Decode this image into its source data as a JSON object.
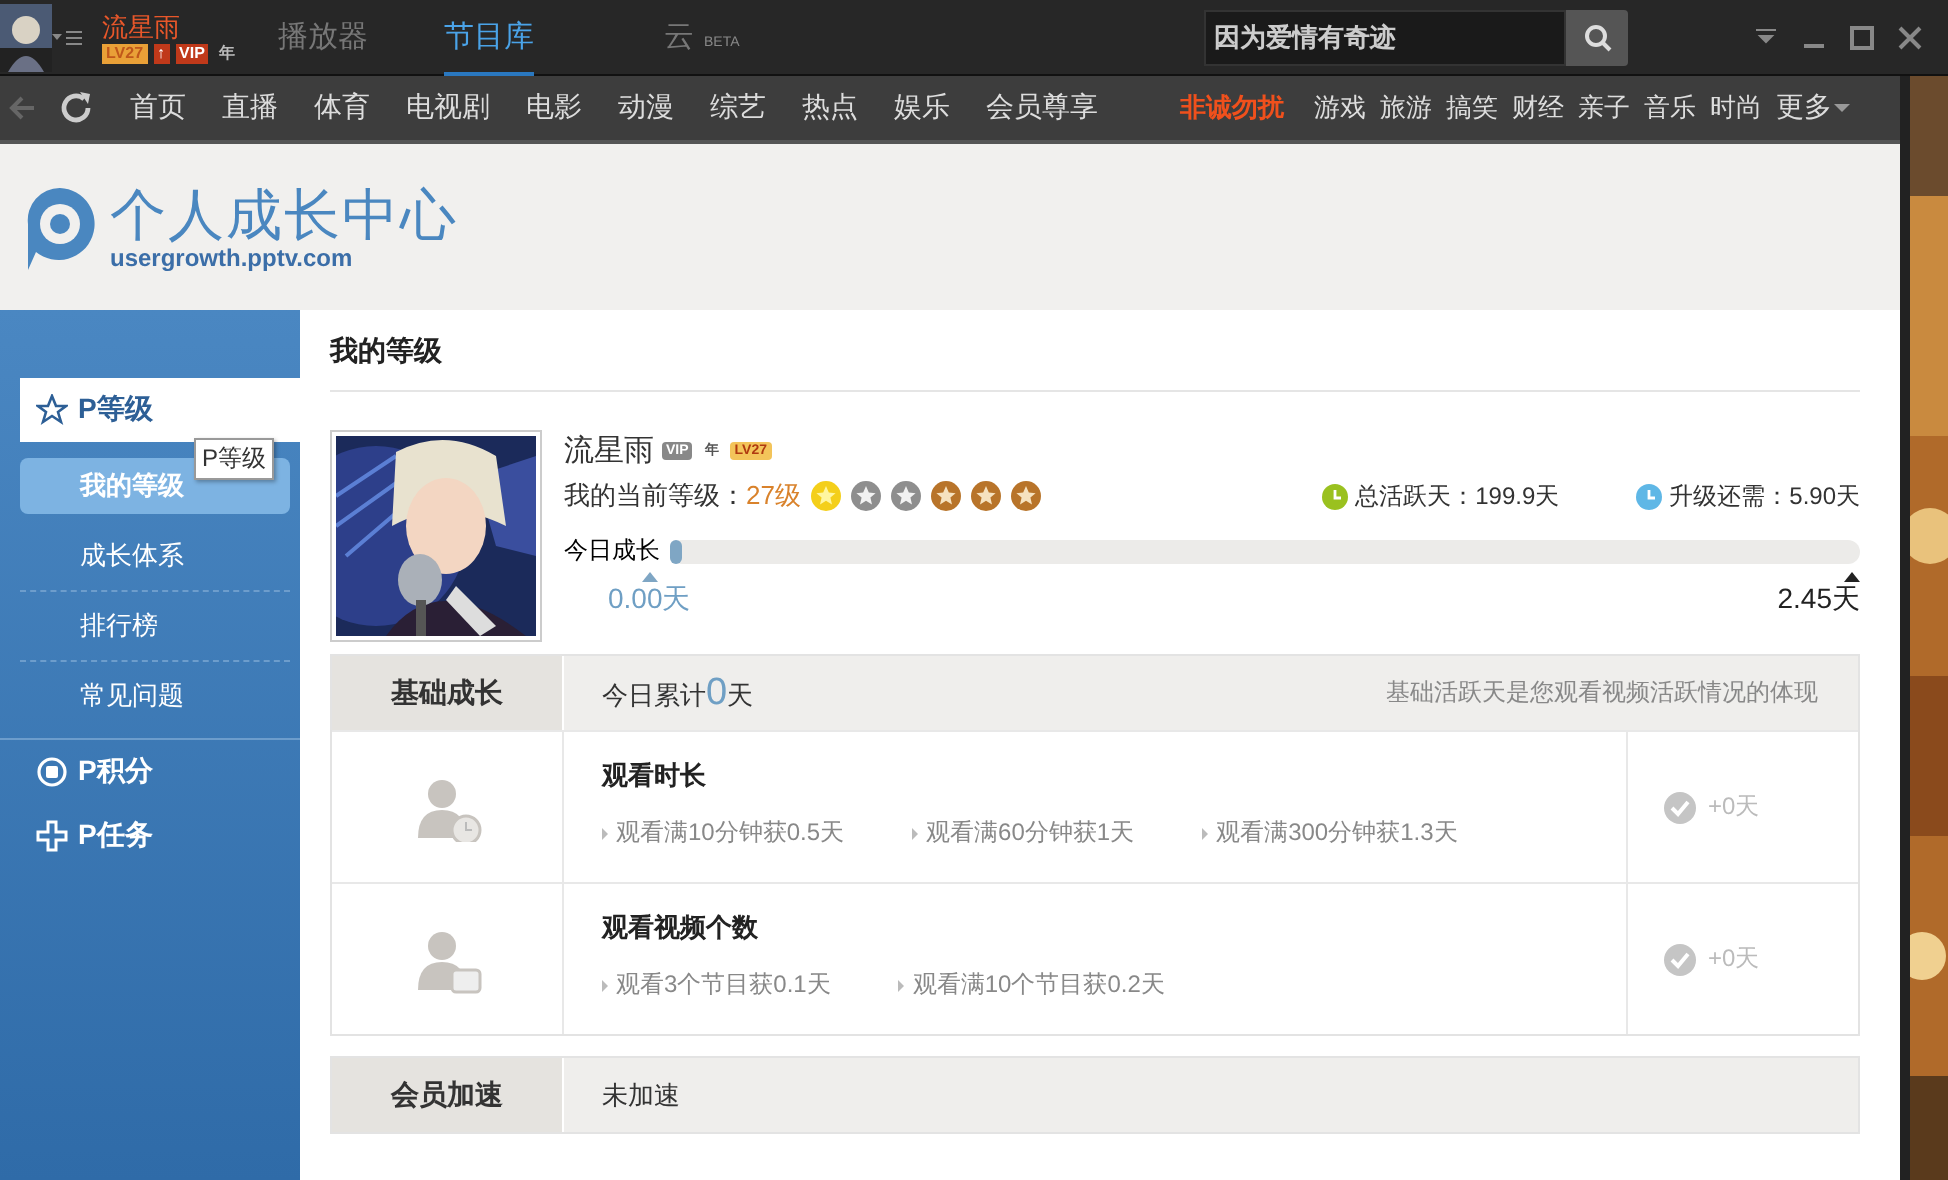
{
  "titlebar": {
    "username": "流星雨",
    "badges": [
      {
        "label": "LV27",
        "kind": "level"
      },
      {
        "label": "↑",
        "kind": "up"
      },
      {
        "label": "VIP",
        "kind": "vip"
      },
      {
        "label": "年",
        "kind": "year"
      }
    ],
    "tabs": [
      {
        "label": "播放器",
        "selected": false
      },
      {
        "label": "节目库",
        "selected": true
      },
      {
        "label": "云",
        "selected": false,
        "superscript": "BETA"
      }
    ],
    "search": {
      "value": "因为爱情有奇迹"
    }
  },
  "navbar": {
    "items": [
      {
        "label": "首页",
        "kind": "main"
      },
      {
        "label": "直播",
        "kind": "main"
      },
      {
        "label": "体育",
        "kind": "main"
      },
      {
        "label": "电视剧",
        "kind": "main"
      },
      {
        "label": "电影",
        "kind": "main"
      },
      {
        "label": "动漫",
        "kind": "main"
      },
      {
        "label": "综艺",
        "kind": "main"
      },
      {
        "label": "热点",
        "kind": "main"
      },
      {
        "label": "娱乐",
        "kind": "main"
      },
      {
        "label": "会员尊享",
        "kind": "main"
      },
      {
        "label": "非诚勿扰",
        "kind": "highlight"
      },
      {
        "label": "游戏",
        "kind": "minor"
      },
      {
        "label": "旅游",
        "kind": "minor"
      },
      {
        "label": "搞笑",
        "kind": "minor"
      },
      {
        "label": "财经",
        "kind": "minor"
      },
      {
        "label": "亲子",
        "kind": "minor"
      },
      {
        "label": "音乐",
        "kind": "minor"
      },
      {
        "label": "时尚",
        "kind": "minor"
      },
      {
        "label": "更多",
        "kind": "dropdown"
      }
    ]
  },
  "header": {
    "title": "个人成长中心",
    "subtitle": "usergrowth.pptv.com"
  },
  "sidebar": {
    "sections": [
      {
        "label": "P等级",
        "kind": "star",
        "selected": true,
        "children": [
          {
            "label": "我的等级",
            "selected": true
          },
          {
            "label": "成长体系",
            "selected": false
          },
          {
            "label": "排行榜",
            "selected": false
          },
          {
            "label": "常见问题",
            "selected": false
          }
        ]
      },
      {
        "label": "P积分",
        "kind": "target",
        "selected": false
      },
      {
        "label": "P任务",
        "kind": "plus",
        "selected": false
      }
    ],
    "tooltip": "P等级"
  },
  "content": {
    "heading": "我的等级",
    "profile": {
      "name": "流星雨",
      "badges": [
        {
          "label": "VIP",
          "kind": "vip"
        },
        {
          "label": "年",
          "kind": "year"
        },
        {
          "label": "LV27",
          "kind": "level"
        }
      ],
      "level_label": "我的当前等级：",
      "level_value": "27级",
      "medals": [
        {
          "kind": "gold"
        },
        {
          "kind": "silver"
        },
        {
          "kind": "silver"
        },
        {
          "kind": "bronze"
        },
        {
          "kind": "bronze"
        },
        {
          "kind": "bronze"
        }
      ],
      "stats": [
        {
          "kind": "total",
          "text": "总活跃天：199.9天"
        },
        {
          "kind": "upgrade",
          "text": "升级还需：5.90天"
        }
      ],
      "progress": {
        "label": "今日成长",
        "level": 0.005,
        "start": "0.00天",
        "end": "2.45天"
      }
    },
    "sections": [
      {
        "title": "基础成长",
        "summary_prefix": "今日累计",
        "summary_value": "0",
        "summary_suffix": "天",
        "note": "基础活跃天是您观看视频活跃情况的体现",
        "rows": [
          {
            "kind": "clock",
            "title": "观看时长",
            "tasks": [
              "观看满10分钟获0.5天",
              "观看满60分钟获1天",
              "观看满300分钟获1.3天"
            ],
            "reward": "+0天"
          },
          {
            "kind": "screen",
            "title": "观看视频个数",
            "tasks": [
              "观看3个节目获0.1天",
              "观看满10个节目获0.2天"
            ],
            "reward": "+0天"
          }
        ]
      },
      {
        "title": "会员加速",
        "summary_prefix": "未加速"
      }
    ]
  }
}
